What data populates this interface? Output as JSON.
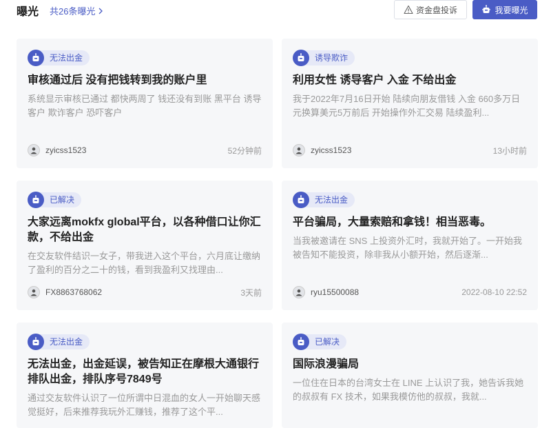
{
  "header": {
    "title": "曝光",
    "count_text": "共26条曝光",
    "complaint_button": "资金盘投诉",
    "expose_button": "我要曝光"
  },
  "colors": {
    "accent": "#4a5cc5",
    "tag_bg": "#e6e9f7",
    "card_bg": "#f6f7f9"
  },
  "cards": [
    {
      "tag": "无法出金",
      "title": "审核通过后 没有把钱转到我的账户里",
      "desc": "系统显示审核已通过 都快两周了 钱还没有到账 黑平台 诱导客户 欺诈客户 恐吓客户",
      "user": "zyicss1523",
      "time": "52分钟前"
    },
    {
      "tag": "诱导欺诈",
      "title": "利用女性 诱导客户 入金 不给出金",
      "desc": "我于2022年7月16日开始 陆续向朋友借钱 入金 660多万日元换算美元5万前后 开始操作外汇交易 陆续盈利...",
      "user": "zyicss1523",
      "time": "13小时前"
    },
    {
      "tag": "已解决",
      "title": "大家远离mokfx global平台，以各种借口让你汇款，不给出金",
      "desc": "在交友软件结识一女子，带我进入这个平台，六月底让缴纳了盈利的百分之二十的钱，看到我盈利又找理由...",
      "user": "FX8863768062",
      "time": "3天前"
    },
    {
      "tag": "无法出金",
      "title": "平台骗局，大量索赔和拿钱！相当恶毒。",
      "desc": "当我被邀请在 SNS 上投资外汇时，我就开始了。一开始我被告知不能投资，除非我从小额开始，然后逐渐...",
      "user": "ryu15500088",
      "time": "2022-08-10 22:52"
    },
    {
      "tag": "无法出金",
      "title": "无法出金，出金延误，被告知正在摩根大通银行排队出金，排队序号7849号",
      "desc": "通过交友软件认识了一位所谓中日混血的女人一开始聊天感觉挺好，后来推荐我玩外汇赚钱，推荐了这个平...",
      "user": "",
      "time": ""
    },
    {
      "tag": "已解决",
      "title": "国际浪漫骗局",
      "desc": "一位住在日本的台湾女士在 LINE 上认识了我，她告诉我她的叔叔有 FX 技术，如果我模仿他的叔叔，我就...",
      "user": "",
      "time": ""
    }
  ]
}
